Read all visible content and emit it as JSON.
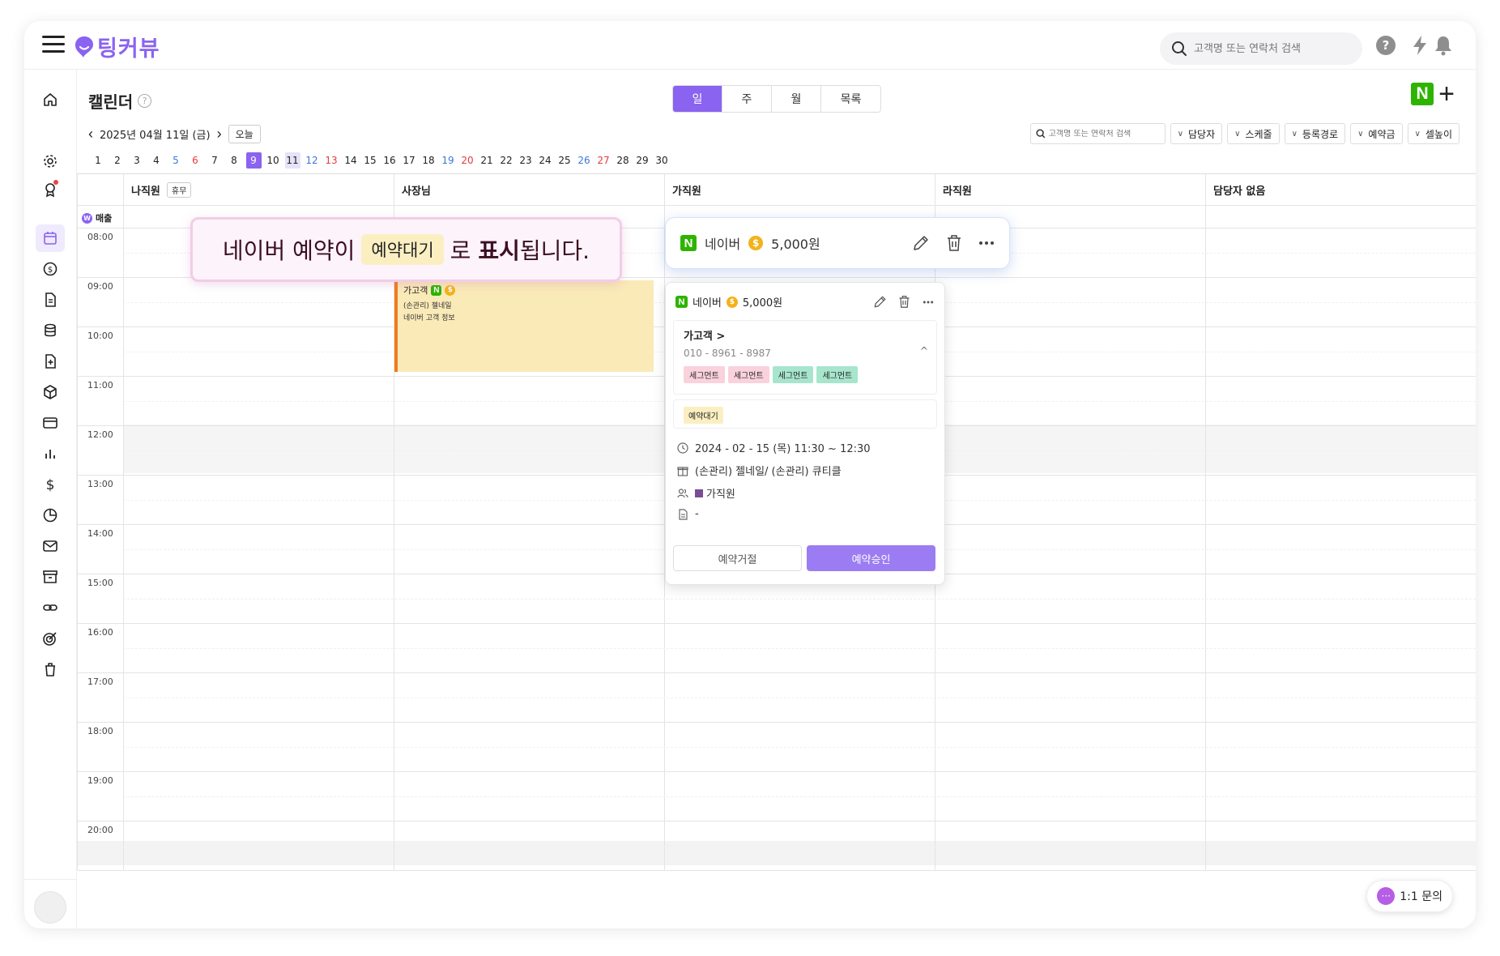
{
  "app": {
    "logo_text": "팅커뷰",
    "brand_color": "#8a63f0"
  },
  "header": {
    "search_placeholder": "고객명 또는 연락처 검색",
    "icons": [
      "menu-icon",
      "search-icon",
      "help-icon",
      "bolt-icon",
      "bell-icon"
    ]
  },
  "sidebar": {
    "icons": [
      "home-icon",
      "settings-icon",
      "badge-icon",
      "calendar-icon",
      "coin-icon",
      "document-icon",
      "database-icon",
      "file-plus-icon",
      "box-icon",
      "card-icon",
      "bar-chart-icon",
      "dollar-icon",
      "pie-chart-icon",
      "mail-icon",
      "archive-icon",
      "link-icon",
      "target-icon",
      "trash-icon"
    ],
    "active": "calendar-icon"
  },
  "page": {
    "title": "캘린더",
    "help_glyph": "?",
    "view_tabs": [
      "일",
      "주",
      "월",
      "목록"
    ],
    "active_tab": "일",
    "date": "2025년 04월 11일 (금)",
    "today_label": "오늘",
    "filter_search_placeholder": "고객명 또는 연락처 검색",
    "filters": [
      "담당자",
      "스케줄",
      "등록경로",
      "예약금",
      "셀높이"
    ],
    "naver_badge": "N",
    "add_glyph": "+"
  },
  "days": {
    "list": [
      "1",
      "2",
      "3",
      "4",
      "5",
      "6",
      "7",
      "8",
      "9",
      "10",
      "11",
      "12",
      "13",
      "14",
      "15",
      "16",
      "17",
      "18",
      "19",
      "20",
      "21",
      "22",
      "23",
      "24",
      "25",
      "26",
      "27",
      "28",
      "29",
      "30"
    ],
    "saturdays": [
      "5",
      "12",
      "19",
      "26"
    ],
    "sundays": [
      "6",
      "13",
      "20",
      "27"
    ],
    "selected": "9",
    "today": "11"
  },
  "calendar": {
    "staff": [
      {
        "name": "나직원",
        "badge": "휴무"
      },
      {
        "name": "사장님",
        "badge": ""
      },
      {
        "name": "가직원",
        "badge": ""
      },
      {
        "name": "라직원",
        "badge": ""
      },
      {
        "name": "담당자 없음",
        "badge": ""
      }
    ],
    "sales_label": "매출",
    "sales_glyph": "W",
    "times": [
      "08:00",
      "09:00",
      "10:00",
      "11:00",
      "12:00",
      "13:00",
      "14:00",
      "15:00",
      "16:00",
      "17:00",
      "18:00",
      "19:00",
      "20:00"
    ]
  },
  "event": {
    "customer": "가고객",
    "line1": "(손관리) 젤네일",
    "line2": "네이버 고객 정보",
    "naver_badge": "N",
    "coin_glyph": "$",
    "color_bg": "#faeab8",
    "color_bar": "#f07b1e"
  },
  "callout": {
    "part1": "네이버 예약이",
    "chip": "예약대기",
    "part2": "로",
    "bold": "표시",
    "part3": "됩니다."
  },
  "tool_card": {
    "source": "네이버",
    "amount": "5,000원",
    "naver_badge": "N",
    "coin_glyph": "$"
  },
  "popup": {
    "source": "네이버",
    "amount": "5,000원",
    "naver_badge": "N",
    "coin_glyph": "$",
    "customer": "가고객 >",
    "phone": "010 - 8961 - 8987",
    "caret": "^",
    "tags": [
      {
        "label": "세그먼트",
        "color": "pink"
      },
      {
        "label": "세그먼트",
        "color": "pink"
      },
      {
        "label": "세그먼트",
        "color": "green"
      },
      {
        "label": "세그먼트",
        "color": "green"
      }
    ],
    "status": "예약대기",
    "datetime": "2024 - 02 - 15 (목) 11:30 ~ 12:30",
    "service": "(손관리) 젤네일/ (손관리) 큐티클",
    "staff": "가직원",
    "memo": "-",
    "reject_label": "예약거절",
    "approve_label": "예약승인"
  },
  "chat": {
    "label": "1:1 문의",
    "glyph": "···"
  }
}
